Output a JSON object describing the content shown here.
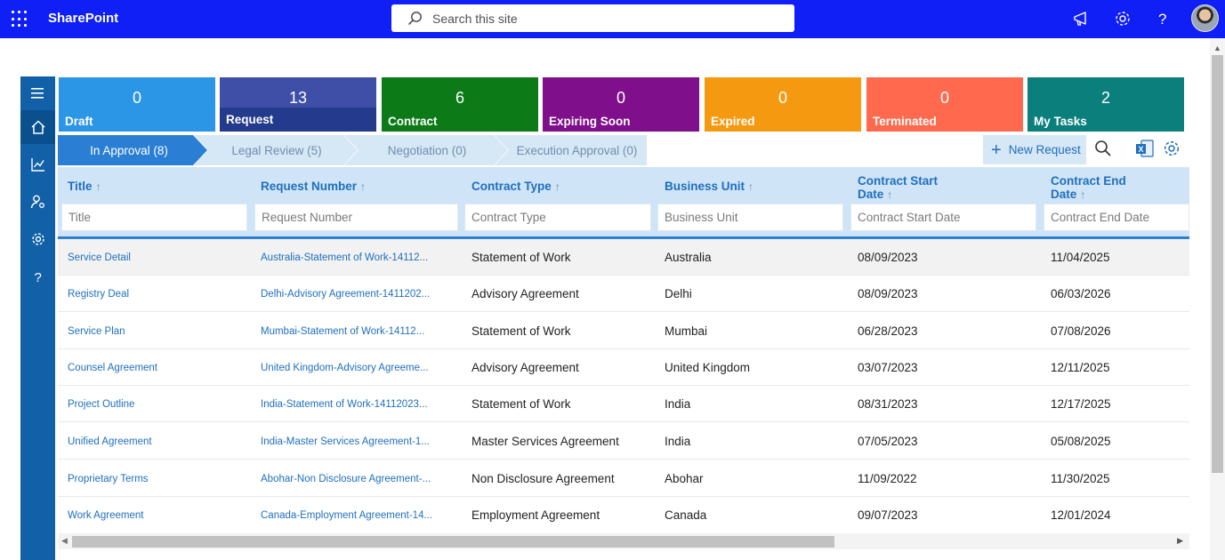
{
  "suitebar": {
    "brand": "SharePoint",
    "search_placeholder": "Search this site"
  },
  "tiles": [
    {
      "count": "0",
      "label": "Draft",
      "color": "#2b95e6"
    },
    {
      "count": "13",
      "label": "Request",
      "color": "#3f4fa8"
    },
    {
      "count": "6",
      "label": "Contract",
      "color": "#0c7b17"
    },
    {
      "count": "0",
      "label": "Expiring Soon",
      "color": "#7f0f8a"
    },
    {
      "count": "0",
      "label": "Expired",
      "color": "#f59a10"
    },
    {
      "count": "0",
      "label": "Terminated",
      "color": "#ff6a4e"
    },
    {
      "count": "2",
      "label": "My Tasks",
      "color": "#0b7f7c"
    }
  ],
  "stages": [
    {
      "label": "In Approval (8)",
      "active": true
    },
    {
      "label": "Legal Review (5)",
      "active": false
    },
    {
      "label": "Negotiation (0)",
      "active": false
    },
    {
      "label": "Execution Approval (0)",
      "active": false
    }
  ],
  "toolbar": {
    "new_request": "New Request"
  },
  "columns": [
    {
      "label": "Title",
      "sort": "↑",
      "filter": "Title"
    },
    {
      "label": "Request Number",
      "sort": "↑",
      "filter": "Request Number"
    },
    {
      "label": "Contract Type",
      "sort": "↑",
      "filter": "Contract Type"
    },
    {
      "label": "Business Unit",
      "sort": "↑",
      "filter": "Business Unit"
    },
    {
      "label": "Contract Start Date",
      "sort": "↑",
      "filter": "Contract Start Date"
    },
    {
      "label": "Contract End Date",
      "sort": "↑",
      "filter": "Contract End Date"
    }
  ],
  "rows": [
    {
      "title": "Service Detail",
      "request": "Australia-Statement of Work-14112...",
      "type": "Statement of Work",
      "unit": "Australia",
      "start": "08/09/2023",
      "end": "11/04/2025"
    },
    {
      "title": "Registry Deal",
      "request": "Delhi-Advisory Agreement-1411202...",
      "type": "Advisory Agreement",
      "unit": "Delhi",
      "start": "08/09/2023",
      "end": "06/03/2026"
    },
    {
      "title": "Service Plan",
      "request": "Mumbai-Statement of Work-14112...",
      "type": "Statement of Work",
      "unit": "Mumbai",
      "start": "06/28/2023",
      "end": "07/08/2026"
    },
    {
      "title": "Counsel Agreement",
      "request": "United Kingdom-Advisory Agreeme...",
      "type": "Advisory Agreement",
      "unit": "United Kingdom",
      "start": "03/07/2023",
      "end": "12/11/2025"
    },
    {
      "title": "Project Outline",
      "request": "India-Statement of Work-14112023...",
      "type": "Statement of Work",
      "unit": "India",
      "start": "08/31/2023",
      "end": "12/17/2025"
    },
    {
      "title": "Unified Agreement",
      "request": "India-Master Services Agreement-1...",
      "type": "Master Services Agreement",
      "unit": "India",
      "start": "07/05/2023",
      "end": "05/08/2025"
    },
    {
      "title": "Proprietary Terms",
      "request": "Abohar-Non Disclosure Agreement-...",
      "type": "Non Disclosure Agreement",
      "unit": "Abohar",
      "start": "11/09/2022",
      "end": "11/30/2025"
    },
    {
      "title": "Work Agreement",
      "request": "Canada-Employment Agreement-14...",
      "type": "Employment Agreement",
      "unit": "Canada",
      "start": "09/07/2023",
      "end": "12/01/2024"
    }
  ]
}
